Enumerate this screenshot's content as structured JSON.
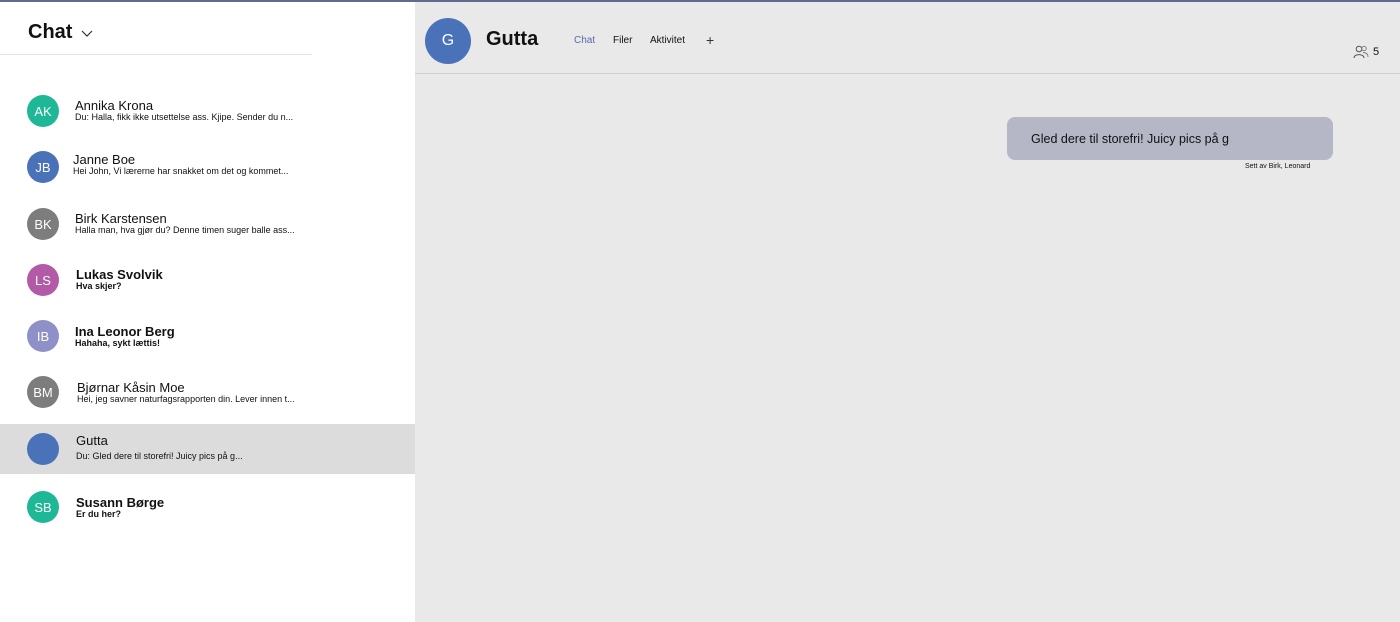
{
  "sidebar": {
    "title": "Chat",
    "items": [
      {
        "initials": "AK",
        "name": "Annika Krona",
        "preview": "Du: Halla, fikk ikke utsettelse ass. Kjipe. Sender du n...",
        "color": "#1fb896",
        "unread": false
      },
      {
        "initials": "JB",
        "name": "Janne Boe",
        "preview": "Hei John,  Vi lærerne har snakket om det og kommet...",
        "color": "#4a72b8",
        "unread": false
      },
      {
        "initials": "BK",
        "name": "Birk Karstensen",
        "preview": "Halla man, hva gjør du? Denne timen suger balle ass...",
        "color": "#7d7d7d",
        "unread": false
      },
      {
        "initials": "LS",
        "name": "Lukas Svolvik",
        "preview": "Hva skjer?",
        "color": "#b25aa5",
        "unread": true
      },
      {
        "initials": "IB",
        "name": "Ina Leonor Berg",
        "preview": "Hahaha, sykt lættis!",
        "color": "#8f90c8",
        "unread": true
      },
      {
        "initials": "BM",
        "name": "Bjørnar Kåsin Moe",
        "preview": "Hei, jeg savner naturfagsrapporten din. Lever innen t...",
        "color": "#7d7d7d",
        "unread": false
      },
      {
        "initials": "",
        "name": "Gutta",
        "preview": "Du: Gled dere til storefri! Juicy pics på g...",
        "color": "#4a72b8",
        "unread": false,
        "selected": true
      },
      {
        "initials": "SB",
        "name": "Susann Børge",
        "preview": "Er du her?",
        "color": "#1fb896",
        "unread": true
      }
    ]
  },
  "conversation": {
    "avatar_initial": "G",
    "title": "Gutta",
    "tabs": [
      "Chat",
      "Filer",
      "Aktivitet"
    ],
    "active_tab": "Chat",
    "add_tab_label": "+",
    "participant_count": "5",
    "messages": [
      {
        "text": "Gled dere til storefri! Juicy pics på g",
        "seen_by": "Sett av Birk, Leonard"
      }
    ]
  },
  "colors": {
    "accent": "#5c6aa8",
    "bubble": "#b5b7c6",
    "selected_row": "#dcdcdc",
    "chat_background": "#e9e9e9"
  },
  "icons": [
    "chevron-down-icon",
    "people-icon"
  ]
}
